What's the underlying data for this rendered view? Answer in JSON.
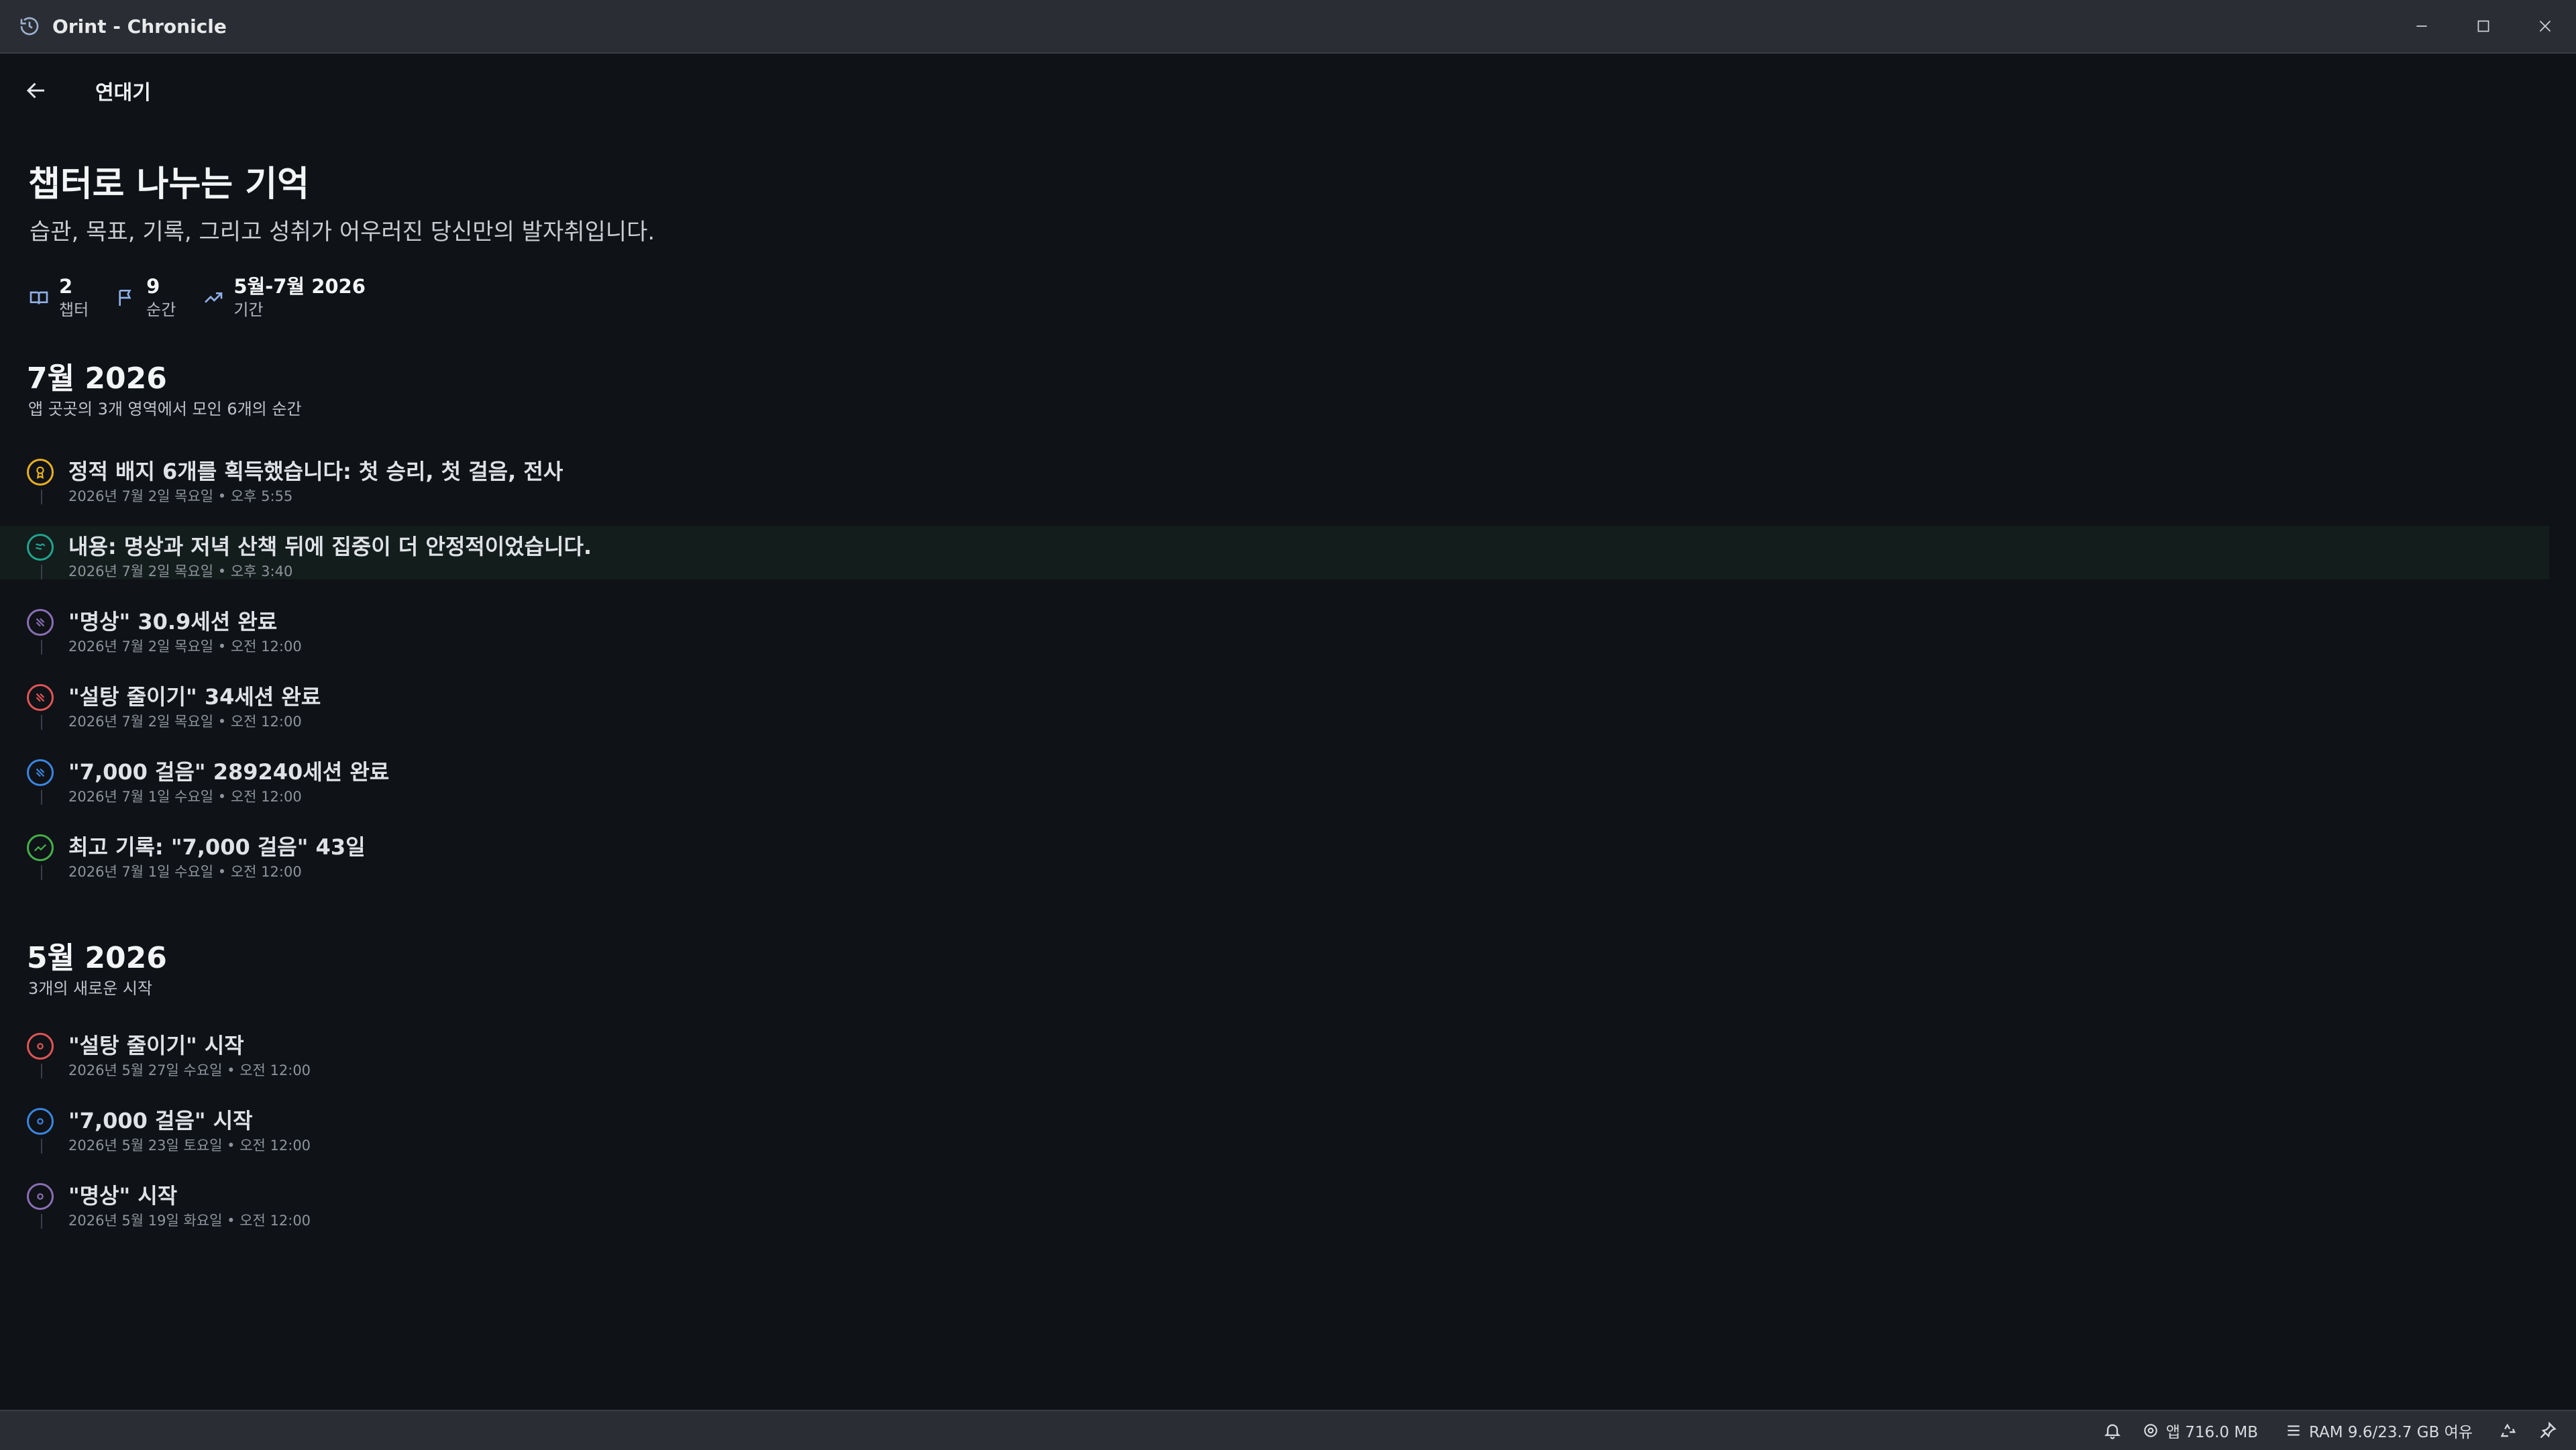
{
  "window": {
    "title": "Orint - Chronicle",
    "icon": "history-icon"
  },
  "header": {
    "title": "연대기"
  },
  "hero": {
    "title": "챕터로 나누는 기억",
    "subtitle": "습관, 목표, 기록, 그리고 성취가 어우러진 당신만의 발자취입니다."
  },
  "stats": [
    {
      "value": "2",
      "label": "챕터",
      "icon": "book-icon"
    },
    {
      "value": "9",
      "label": "순간",
      "icon": "flag-icon"
    },
    {
      "value": "5월-7월 2026",
      "label": "기간",
      "icon": "trend-icon"
    }
  ],
  "sections": [
    {
      "title": "7월 2026",
      "subtitle": "앱 곳곳의 3개 영역에서 모인 6개의 순간",
      "events": [
        {
          "title": "정적 배지 6개를 획득했습니다: 첫 승리, 첫 걸음, 전사",
          "time": "2026년 7월 2일 목요일 • 오후 5:55",
          "color": "#e8b020",
          "icon": "badge-icon"
        },
        {
          "title": "내용: 명상과 저녁 산책 뒤에 집중이 더 안정적이었습니다.",
          "time": "2026년 7월 2일 목요일 • 오후 3:40",
          "color": "#21a38f",
          "icon": "note-icon",
          "highlight": true
        },
        {
          "title": "\"명상\" 30.9세션 완료",
          "time": "2026년 7월 2일 목요일 • 오전 12:00",
          "color": "#8a6fb4",
          "icon": "session-icon"
        },
        {
          "title": "\"설탕 줄이기\" 34세션 완료",
          "time": "2026년 7월 2일 목요일 • 오전 12:00",
          "color": "#e05555",
          "icon": "session-icon"
        },
        {
          "title": "\"7,000 걸음\" 289240세션 완료",
          "time": "2026년 7월 1일 수요일 • 오전 12:00",
          "color": "#3a86e0",
          "icon": "session-icon"
        },
        {
          "title": "최고 기록: \"7,000 걸음\" 43일",
          "time": "2026년 7월 1일 수요일 • 오전 12:00",
          "color": "#44b04a",
          "icon": "trend-icon"
        }
      ]
    },
    {
      "title": "5월 2026",
      "subtitle": "3개의 새로운 시작",
      "events": [
        {
          "title": "\"설탕 줄이기\" 시작",
          "time": "2026년 5월 27일 수요일 • 오전 12:00",
          "color": "#e05555",
          "icon": "start-icon"
        },
        {
          "title": "\"7,000 걸음\" 시작",
          "time": "2026년 5월 23일 토요일 • 오전 12:00",
          "color": "#3a86e0",
          "icon": "start-icon"
        },
        {
          "title": "\"명상\" 시작",
          "time": "2026년 5월 19일 화요일 • 오전 12:00",
          "color": "#8a6fb4",
          "icon": "start-icon"
        }
      ]
    }
  ],
  "statusbar": {
    "app_memory": "앱 716.0 MB",
    "ram": "RAM 9.6/23.7 GB 여유"
  }
}
